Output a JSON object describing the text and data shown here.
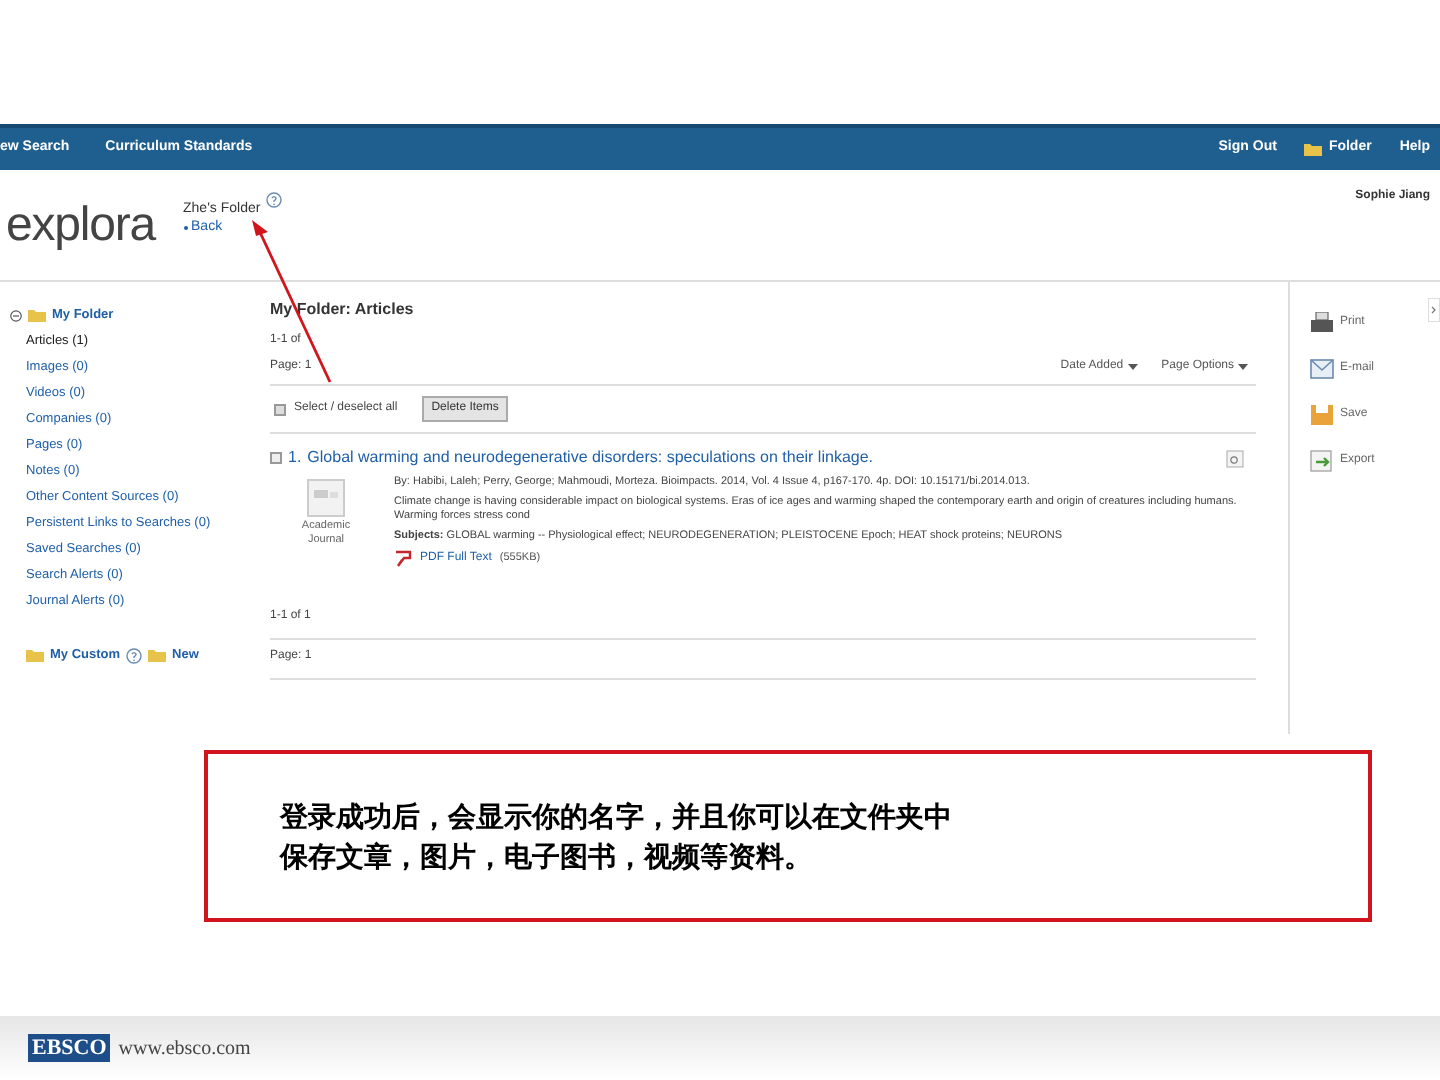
{
  "nav": {
    "left": [
      "ew Search",
      "Curriculum Standards"
    ],
    "right": [
      {
        "kind": "link",
        "label": "Sign Out"
      },
      {
        "kind": "folder",
        "label": "Folder"
      },
      {
        "kind": "link",
        "label": "Help"
      }
    ]
  },
  "header": {
    "logo": "explora",
    "folder_title": "Zhe's Folder",
    "back": "Back",
    "user": "Sophie Jiang"
  },
  "sidebar": {
    "title": "My Folder",
    "expanded": true,
    "items": [
      {
        "label": "Articles (1)",
        "selected": true
      },
      {
        "label": "Images (0)",
        "selected": false
      },
      {
        "label": "Videos (0)",
        "selected": false
      },
      {
        "label": "Companies (0)",
        "selected": false
      },
      {
        "label": "Pages (0)",
        "selected": false
      },
      {
        "label": "Notes (0)",
        "selected": false
      },
      {
        "label": "Other Content Sources (0)",
        "selected": false
      },
      {
        "label": "Persistent Links to Searches (0)",
        "selected": false
      },
      {
        "label": "Saved Searches (0)",
        "selected": false
      },
      {
        "label": "Search Alerts (0)",
        "selected": false
      },
      {
        "label": "Journal Alerts (0)",
        "selected": false
      }
    ],
    "custom": "My Custom",
    "new": "New"
  },
  "main": {
    "title": "My Folder: Articles",
    "count_top": "1-1 of",
    "page_top": "Page: 1",
    "sort": "Date Added",
    "page_options": "Page Options",
    "select_all": {
      "label": "Select / deselect all",
      "checked": false
    },
    "delete": "Delete Items",
    "results": [
      {
        "number": "1.",
        "title": "Global warming and neurodegenerative disorders: speculations on their linkage.",
        "checked": false,
        "type": "Academic Journal",
        "byline": "By: Habibi, Laleh; Perry, George; Mahmoudi, Morteza. Bioimpacts. 2014, Vol. 4 Issue 4, p167-170. 4p. DOI: 10.15171/bi.2014.013.",
        "abstract": "Climate change is having considerable impact on biological systems. Eras of ice ages and warming shaped the contemporary earth and origin of creatures including humans. Warming forces stress cond",
        "subjects": "**Subjects:** GLOBAL warming -- Physiological effect; NEURODEGENERATION; PLEISTOCENE Epoch; HEAT shock proteins; NEURONS",
        "pdf": "PDF Full Text",
        "pdf_size": "(555KB)"
      }
    ],
    "count_bottom": "1-1 of 1",
    "page_bottom": "Page: 1"
  },
  "tools": [
    {
      "kind": "print",
      "label": "Print"
    },
    {
      "kind": "email",
      "label": "E-mail"
    },
    {
      "kind": "save",
      "label": "Save"
    },
    {
      "kind": "export",
      "label": "Export"
    }
  ],
  "callout": {
    "lines": [
      "登录成功后，会显示你的名字，并且你可以在文件夹中",
      "保存文章，图片，电子图书，视频等资料。"
    ]
  },
  "footer": {
    "logo": "EBSCO",
    "url": "www.ebsco.com"
  }
}
